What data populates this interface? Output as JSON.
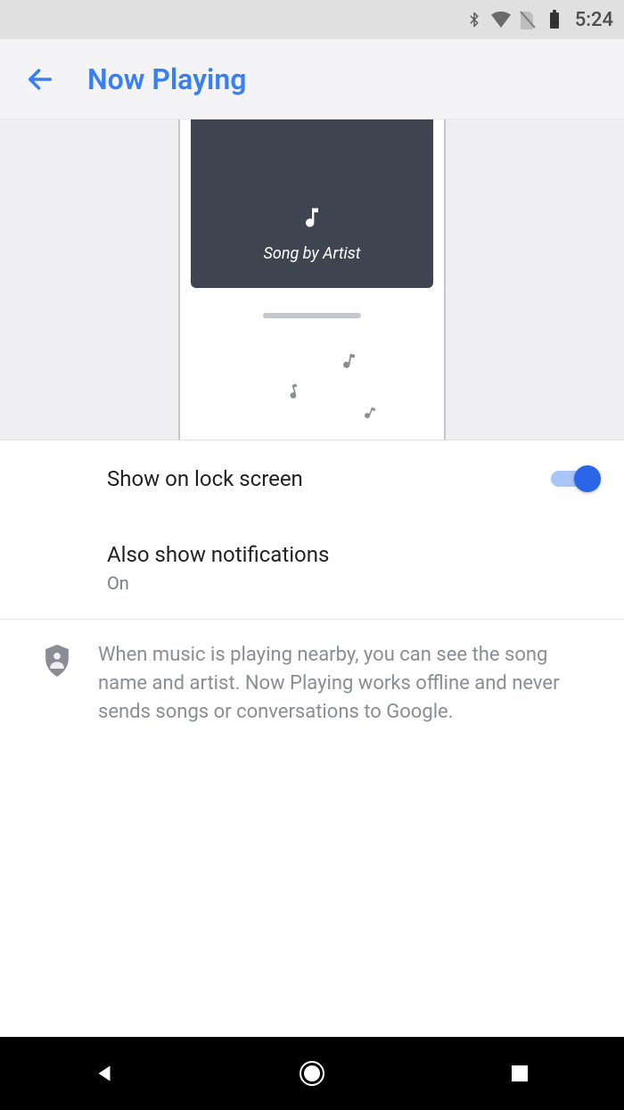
{
  "status": {
    "time": "5:24"
  },
  "header": {
    "title": "Now Playing"
  },
  "hero": {
    "song_line": "Song by Artist"
  },
  "settings": {
    "lock_screen": {
      "label": "Show on lock screen",
      "toggled": true
    },
    "notifications": {
      "label": "Also show notifications",
      "value": "On"
    }
  },
  "info": {
    "text": "When music is playing nearby, you can see the song name and artist. Now Playing works offline and never sends songs or conversations to Google."
  }
}
